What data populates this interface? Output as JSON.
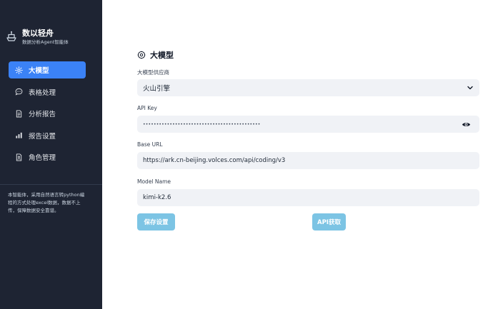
{
  "brand": {
    "title": "数以轻舟",
    "subtitle": "数据分析Agent智能体"
  },
  "sidebar": {
    "items": [
      {
        "label": "大模型",
        "icon": "gear-icon",
        "active": true
      },
      {
        "label": "表格处理",
        "icon": "chat-icon",
        "active": false
      },
      {
        "label": "分析报告",
        "icon": "document-icon",
        "active": false
      },
      {
        "label": "报告设置",
        "icon": "bar-chart-icon",
        "active": false
      },
      {
        "label": "角色管理",
        "icon": "user-file-icon",
        "active": false
      }
    ],
    "description": "本智能体，采用自然语言转python编程的方式处理excel数据，数据不上传，保障数据安全靠谱。"
  },
  "section": {
    "title": "大模型"
  },
  "form": {
    "provider_label": "大模型供应商",
    "provider_value": "火山引擎",
    "api_key_label": "API Key",
    "api_key_masked": "••••••••••••••••••••••••••••••••••••••••••••",
    "base_url_label": "Base URL",
    "base_url_value": "https://ark.cn-beijing.volces.com/api/coding/v3",
    "model_name_label": "Model Name",
    "model_name_value": "kimi-k2.6"
  },
  "buttons": {
    "save_label": "保存设置",
    "api_label": "API获取"
  },
  "colors": {
    "sidebar_bg": "#1e2433",
    "active_item": "#3b82f6",
    "button": "#7cc4e4",
    "field_bg": "#f0f2f6"
  }
}
